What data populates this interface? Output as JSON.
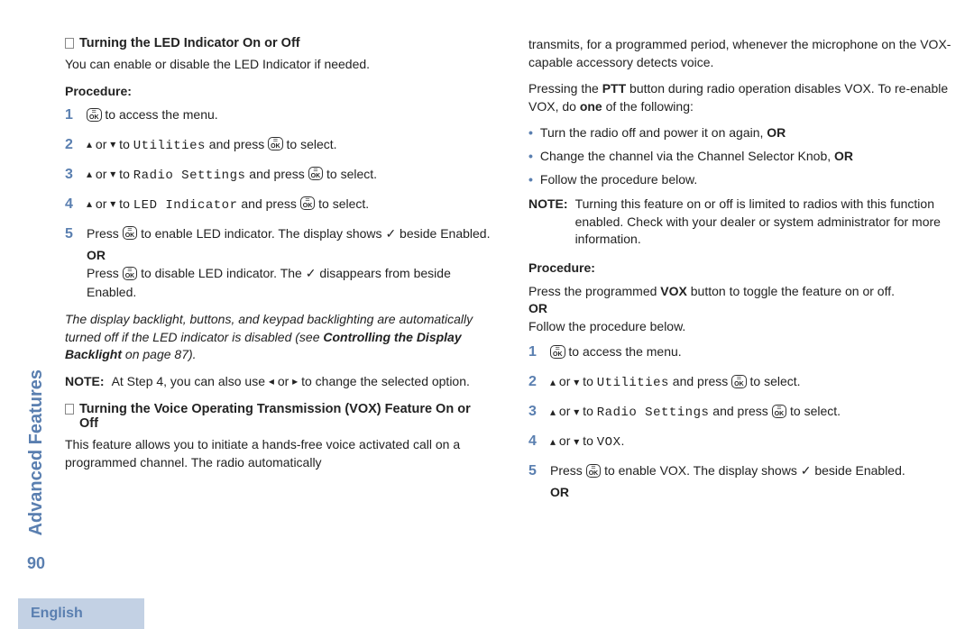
{
  "sidebar": {
    "section_label": "Advanced Features",
    "page_number": "90"
  },
  "left": {
    "h1": "Turning the LED Indicator On or Off",
    "intro": "You can enable or disable the LED Indicator if needed.",
    "procedure_label": "Procedure:",
    "steps": {
      "s1": {
        "num": "1",
        "tail": " to access the menu."
      },
      "s2": {
        "num": "2",
        "or": " or ",
        "to": " to ",
        "target": "Utilities",
        "press": " and press ",
        "tail": " to select."
      },
      "s3": {
        "num": "3",
        "or": " or ",
        "to": " to ",
        "target": "Radio Settings",
        "press": " and press ",
        "tail": " to select."
      },
      "s4": {
        "num": "4",
        "or": " or ",
        "to": " to ",
        "target": "LED Indicator",
        "press": " and press ",
        "tail": " to select."
      },
      "s5": {
        "num": "5",
        "a_pre": "Press ",
        "a_post": " to enable LED indicator. The display shows ",
        "a_tail": " beside Enabled.",
        "or": "OR",
        "b_pre": "Press ",
        "b_post": " to disable LED indicator. The ",
        "b_tail": " disappears from beside Enabled."
      }
    },
    "italic_note_1": "The display backlight, buttons, and keypad backlighting are automatically turned off if the LED indicator is disabled (see ",
    "italic_note_bold": "Controlling the Display Backlight",
    "italic_note_2": " on page 87).",
    "note_label": "NOTE:",
    "note_text_1": "At Step 4, you can also use ",
    "note_or": " or ",
    "note_text_2": " to change the selected option.",
    "h2": "Turning the Voice Operating Transmission (VOX) Feature On or Off",
    "h2_intro": "This feature allows you to initiate a hands-free voice activated call on a programmed channel. The radio automatically"
  },
  "right": {
    "cont": "transmits, for a programmed period, whenever the microphone on the VOX-capable accessory detects voice.",
    "ptt_1": "Pressing the ",
    "ptt_bold": "PTT",
    "ptt_2": " button during radio operation disables VOX. To re-enable VOX, do ",
    "one_bold": "one",
    "ptt_3": " of the following:",
    "bullets": {
      "b1": {
        "text": "Turn the radio off and power it on again, ",
        "or": "OR"
      },
      "b2": {
        "text": "Change the channel via the Channel Selector Knob, ",
        "or": "OR"
      },
      "b3": {
        "text": "Follow the procedure below."
      }
    },
    "note_label": "NOTE:",
    "note_text": "Turning this feature on or off is limited to radios with this function enabled. Check with your dealer or system administrator for more information.",
    "procedure_label": "Procedure:",
    "proc_intro_1": "Press the programmed ",
    "proc_intro_bold": "VOX",
    "proc_intro_2": " button to toggle the feature on or off.",
    "proc_or": "OR",
    "proc_follow": "Follow the procedure below.",
    "steps": {
      "s1": {
        "num": "1",
        "tail": " to access the menu."
      },
      "s2": {
        "num": "2",
        "or": " or ",
        "to": " to ",
        "target": "Utilities",
        "press": " and press ",
        "tail": " to select."
      },
      "s3": {
        "num": "3",
        "or": " or ",
        "to": " to ",
        "target": "Radio Settings",
        "press": " and press ",
        "tail": " to select."
      },
      "s4": {
        "num": "4",
        "or": " or ",
        "to": " to ",
        "target": "VOX",
        "tail": "."
      },
      "s5": {
        "num": "5",
        "a_pre": "Press ",
        "a_post": " to enable VOX. The display shows ",
        "a_tail": " beside Enabled.",
        "or": "OR"
      }
    }
  },
  "footer": {
    "lang": "English"
  }
}
